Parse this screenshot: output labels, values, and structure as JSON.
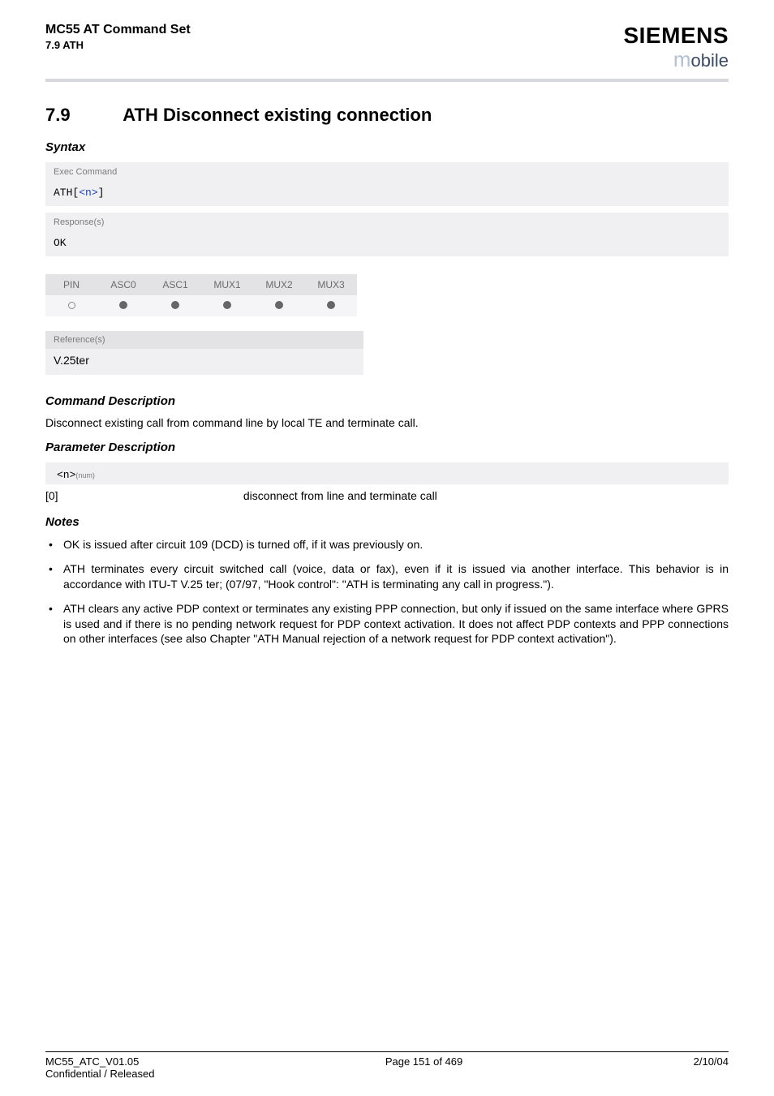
{
  "header": {
    "doc_title": "MC55 AT Command Set",
    "doc_sub": "7.9 ATH",
    "logo_top": "SIEMENS",
    "logo_bottom_m": "m",
    "logo_bottom_rest": "obile"
  },
  "section": {
    "num": "7.9",
    "title": "ATH   Disconnect existing connection"
  },
  "syntax": {
    "heading": "Syntax",
    "exec_label": "Exec Command",
    "exec_cmd_prefix": "ATH",
    "exec_cmd_bracket_open": "[",
    "exec_cmd_param": "<n>",
    "exec_cmd_bracket_close": "]",
    "response_label": "Response(s)",
    "response_text": "OK"
  },
  "support": {
    "headers": [
      "PIN",
      "ASC0",
      "ASC1",
      "MUX1",
      "MUX2",
      "MUX3"
    ],
    "row": [
      "open",
      "filled",
      "filled",
      "filled",
      "filled",
      "filled"
    ]
  },
  "refs": {
    "heading": "Reference(s)",
    "body": "V.25ter"
  },
  "cmd_desc": {
    "heading": "Command Description",
    "text": "Disconnect existing call from command line by local TE and terminate call."
  },
  "param_desc": {
    "heading": "Parameter Description",
    "param_code": "<n>",
    "param_sup": "(num)",
    "value_key": "[0]",
    "value_desc": "disconnect from line and terminate call"
  },
  "notes": {
    "heading": "Notes",
    "items": [
      "OK is issued after circuit 109 (DCD) is turned off, if it was previously on.",
      "ATH terminates every circuit switched call (voice, data or fax), even if it is issued via another interface. This behavior is in accordance with ITU-T V.25 ter; (07/97, \"Hook control\": \"ATH is terminating any call in progress.\").",
      "ATH clears any active PDP context or terminates any existing PPP connection, but only if issued on the same interface where GPRS is used and if there is no pending network request for PDP context activation. It does not affect PDP contexts and PPP connections on other interfaces (see also Chapter \"ATH Manual rejection of a network request for PDP context activation\")."
    ]
  },
  "footer": {
    "left_line1": "MC55_ATC_V01.05",
    "left_line2": "Confidential / Released",
    "center": "Page 151 of 469",
    "right": "2/10/04"
  }
}
